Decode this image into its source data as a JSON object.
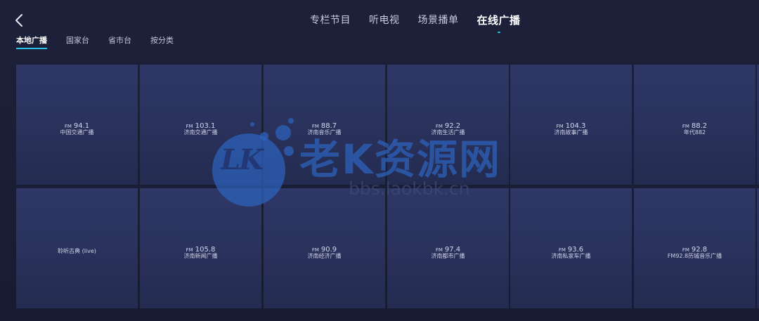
{
  "top_tabs": [
    {
      "label": "专栏节目",
      "active": false
    },
    {
      "label": "听电视",
      "active": false
    },
    {
      "label": "场景播单",
      "active": false
    },
    {
      "label": "在线广播",
      "active": true
    }
  ],
  "sub_tabs": [
    {
      "label": "本地广播",
      "active": true
    },
    {
      "label": "国家台",
      "active": false
    },
    {
      "label": "省市台",
      "active": false
    },
    {
      "label": "按分类",
      "active": false
    }
  ],
  "stations": [
    {
      "prefix": "FM",
      "freq": "94.1",
      "name": "中国交通广播"
    },
    {
      "prefix": "FM",
      "freq": "103.1",
      "name": "济南交通广播"
    },
    {
      "prefix": "FM",
      "freq": "88.7",
      "name": "济南音乐广播"
    },
    {
      "prefix": "FM",
      "freq": "92.2",
      "name": "济南生活广播"
    },
    {
      "prefix": "FM",
      "freq": "104.3",
      "name": "济南故事广播"
    },
    {
      "prefix": "FM",
      "freq": "88.2",
      "name": "年代882"
    },
    {
      "prefix": "",
      "freq": "",
      "name": "聆听古典 (live)"
    },
    {
      "prefix": "FM",
      "freq": "105.8",
      "name": "济南新闻广播"
    },
    {
      "prefix": "FM",
      "freq": "90.9",
      "name": "济南经济广播"
    },
    {
      "prefix": "FM",
      "freq": "97.4",
      "name": "济南都市广播"
    },
    {
      "prefix": "FM",
      "freq": "93.6",
      "name": "济南私家车广播"
    },
    {
      "prefix": "FM",
      "freq": "92.8",
      "name": "FM92.8历城音乐广播"
    }
  ],
  "watermark": {
    "logo_text": "LK",
    "title": "老K资源网",
    "url": "bbs.laokbk.cn"
  },
  "icons": {
    "back": "back-arrow-icon"
  },
  "colors": {
    "accent": "#27c4e6",
    "background": "#1b1f36",
    "card": "#2b335f"
  }
}
